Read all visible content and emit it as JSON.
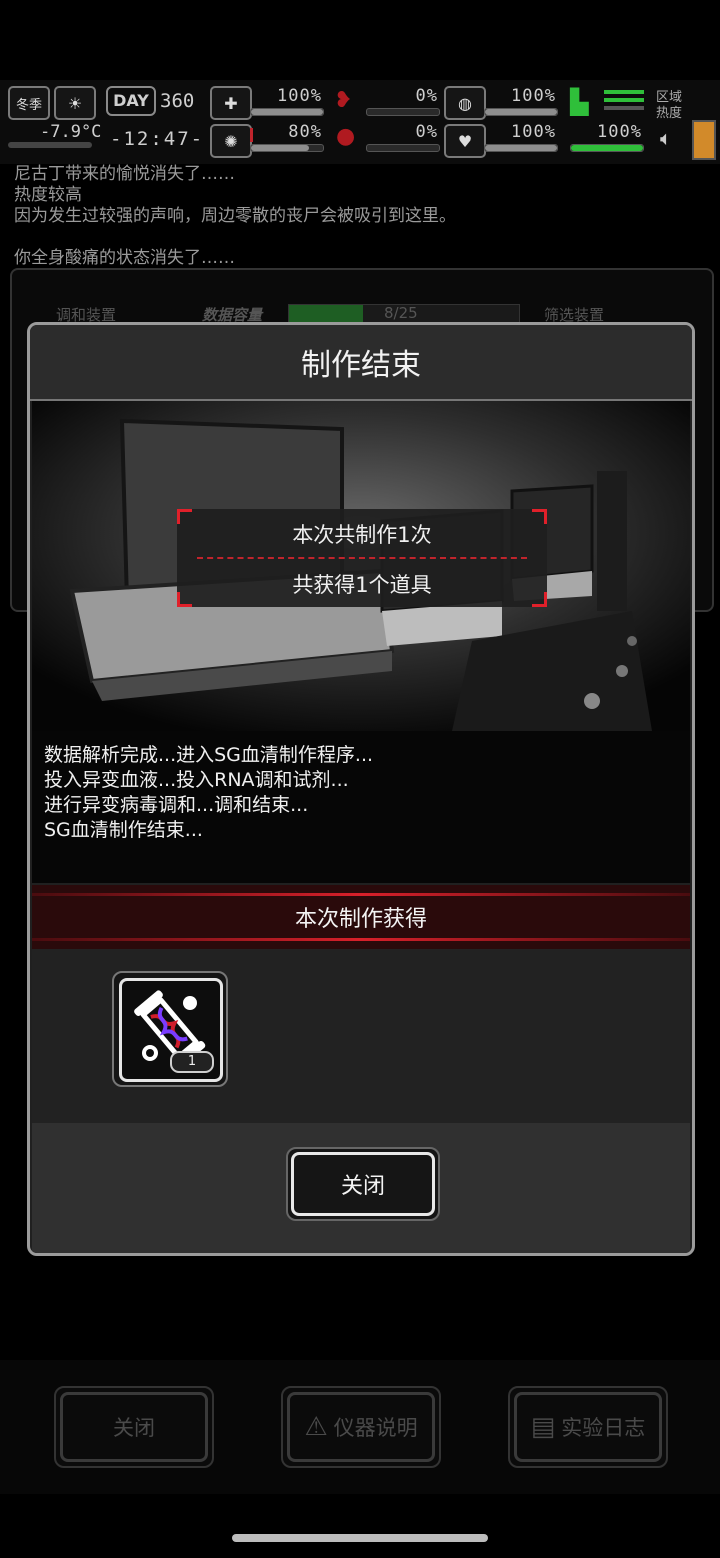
{
  "hud": {
    "season": "冬季",
    "day_label": "DAY",
    "day_number": "360",
    "temperature": "-7.9°C",
    "clock": "-12:47-",
    "region_heat_label": "区域\n热度",
    "stats": [
      {
        "name": "health",
        "value": "100%",
        "fill": 1.0
      },
      {
        "name": "bleeding",
        "value": "0%",
        "fill": 0.0
      },
      {
        "name": "stomach",
        "value": "100%",
        "fill": 1.0
      },
      {
        "name": "mental",
        "value": "80%",
        "fill": 0.8
      },
      {
        "name": "blood",
        "value": "0%",
        "fill": 0.0
      },
      {
        "name": "heart",
        "value": "100%",
        "fill": 1.0
      },
      {
        "name": "stamina",
        "value": "100%",
        "fill": 1.0
      }
    ]
  },
  "log": {
    "lines": [
      "尼古丁带来的愉悦消失了……",
      "热度较高",
      "因为发生过较强的声响，周边零散的丧尸会被吸引到这里。",
      "",
      "你全身酸痛的状态消失了……"
    ]
  },
  "device": {
    "left_label": "调和装置",
    "capacity_label": "数据容量",
    "capacity_value": "8/25",
    "capacity_fill": 0.32,
    "right_label": "筛选装置"
  },
  "dialog": {
    "title": "制作结束",
    "summary_line1": "本次共制作1次",
    "summary_line2": "共获得1个道具",
    "story": [
      "数据解析完成...进入SG血清制作程序...",
      "投入异变血液...投入RNA调和试剂...",
      "进行异变病毒调和...调和结束...",
      "SG血清制作结束..."
    ],
    "gain_header": "本次制作获得",
    "item": {
      "icon": "sg-serum-icon",
      "count": "1"
    },
    "close_label": "关闭"
  },
  "bottom": {
    "close_label": "关闭",
    "manual_label": "仪器说明",
    "log_label": "实验日志"
  },
  "colors": {
    "accent_red": "#d8202a",
    "stamina_green": "#2fbf3a"
  }
}
